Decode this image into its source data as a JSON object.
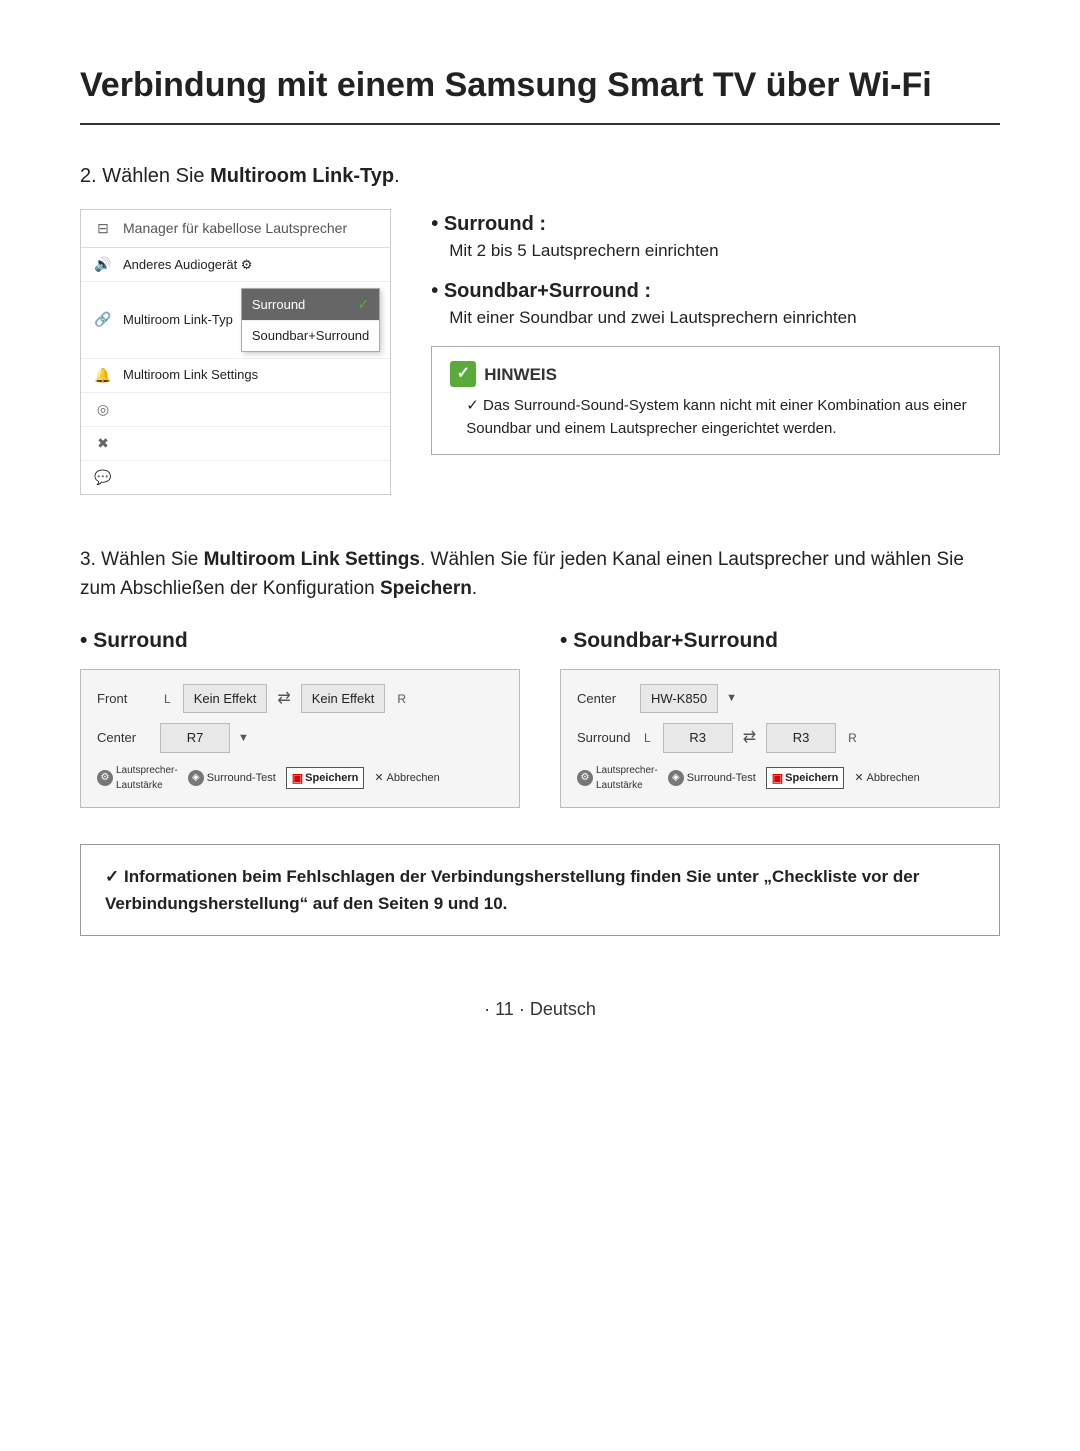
{
  "page": {
    "title": "Verbindung mit einem Samsung Smart TV über Wi-Fi",
    "page_number": "· 11 · Deutsch"
  },
  "step2": {
    "label": "2. Wählen Sie ",
    "label_bold": "Multiroom Link-Typ",
    "label_end": ".",
    "menu": {
      "header": "Manager für kabellose Lautsprecher",
      "rows": [
        {
          "icon": "📷",
          "label": "Anderes Audiogerät ⚙"
        },
        {
          "icon": "🔔",
          "label": "Multiroom Link-Typ",
          "has_dropdown": true
        },
        {
          "icon": "⚙",
          "label": "Multiroom Link Settings"
        },
        {
          "icon": "◎",
          "label": ""
        },
        {
          "icon": "✖",
          "label": ""
        },
        {
          "icon": "💬",
          "label": ""
        }
      ],
      "dropdown": {
        "items": [
          {
            "label": "Surround",
            "selected": true,
            "checkmark": true
          },
          {
            "label": "Soundbar+Surround",
            "selected": false
          }
        ]
      }
    },
    "bullets": [
      {
        "title": "Surround :",
        "desc": "Mit 2 bis 5 Lautsprechern einrichten"
      },
      {
        "title": "Soundbar+Surround :",
        "desc": "Mit einer Soundbar und zwei\nLautsprechern einrichten"
      }
    ],
    "hinweis": {
      "title": "HINWEIS",
      "item": "Das Surround-Sound-System kann nicht mit einer Kombination aus einer Soundbar und einem Lautsprecher eingerichtet werden."
    }
  },
  "step3": {
    "label": "3. Wählen Sie ",
    "label_bold1": "Multiroom Link Settings",
    "label_mid": ". Wählen Sie für jeden Kanal einen Lautsprecher und wählen Sie zum Abschließen der Konfiguration ",
    "label_bold2": "Speichern",
    "label_end": ".",
    "panels": [
      {
        "title": "Surround",
        "rows": [
          {
            "label": "Front",
            "left_side": "L",
            "left_val": "Kein Effekt",
            "right_val": "Kein Effekt",
            "right_side": "R",
            "has_arrow": true
          },
          {
            "label": "Center",
            "left_side": "",
            "left_val": "R7",
            "right_val": "",
            "right_side": "",
            "has_arrow": false
          }
        ],
        "footer": {
          "lautsprecher": "Lautsprecher-\nLautstärke",
          "surround_test": "Surround-Test",
          "speichern": "Speichern",
          "abbrechen": "Abbrechen"
        }
      },
      {
        "title": "Soundbar+Surround",
        "rows": [
          {
            "label": "Center",
            "left_side": "",
            "left_val": "HW-K850",
            "right_val": "",
            "right_side": "",
            "has_arrow": false
          },
          {
            "label": "Surround",
            "left_side": "L",
            "left_val": "R3",
            "right_val": "R3",
            "right_side": "R",
            "has_arrow": true
          }
        ],
        "footer": {
          "lautsprecher": "Lautsprecher-\nLautstärke",
          "surround_test": "Surround-Test",
          "speichern": "Speichern",
          "abbrechen": "Abbrechen"
        }
      }
    ]
  },
  "info_box": {
    "text": " Informationen beim Fehlschlagen der Verbindungsherstellung finden Sie unter „Checkliste vor der Verbindungsherstellung“ auf den Seiten 9 und 10."
  }
}
